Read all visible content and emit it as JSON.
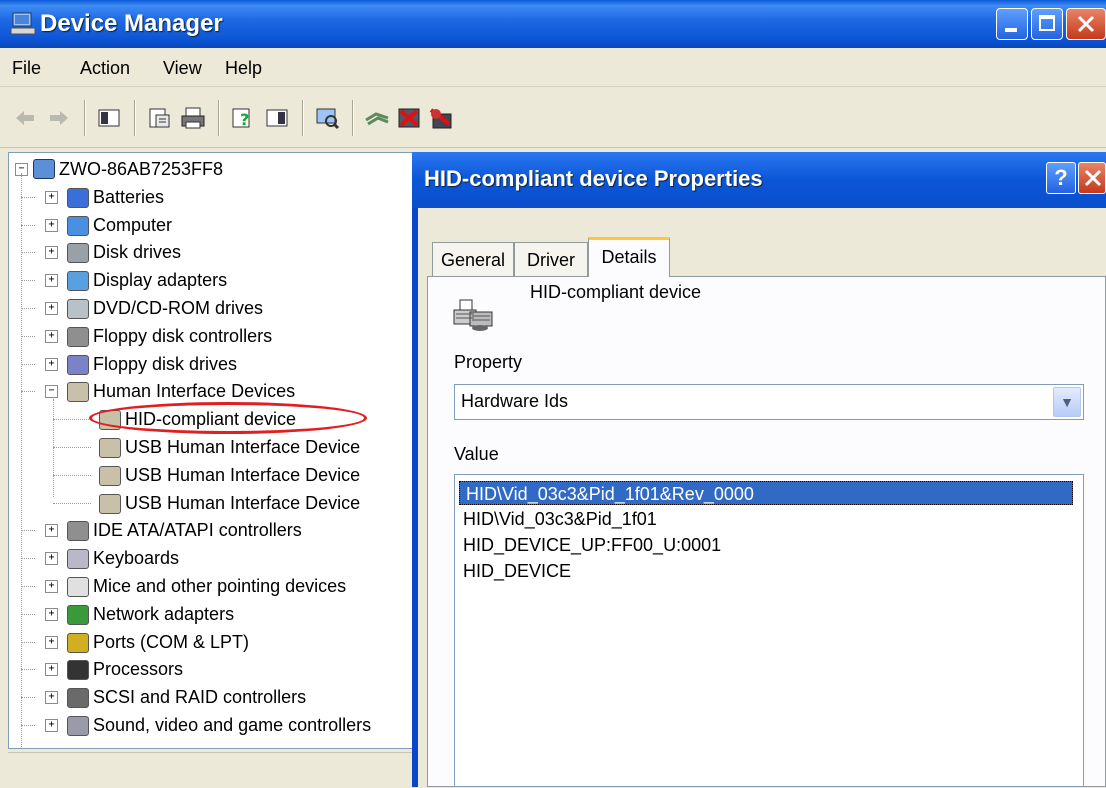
{
  "window": {
    "title": "Device Manager"
  },
  "menu": [
    "File",
    "Action",
    "View",
    "Help"
  ],
  "toolbar": {
    "icons": [
      "back-arrow-icon",
      "forward-arrow-icon",
      "show-hide-tree-icon",
      "properties-icon",
      "print-icon",
      "help-icon",
      "show-hide-pane-icon",
      "scan-hardware-icon",
      "update-driver-icon",
      "disable-device-icon",
      "uninstall-device-icon"
    ]
  },
  "tree": {
    "root": "ZWO-86AB7253FF8",
    "categories": [
      {
        "label": "Batteries",
        "icon": "battery-icon",
        "expanded": false
      },
      {
        "label": "Computer",
        "icon": "computer-icon",
        "expanded": false
      },
      {
        "label": "Disk drives",
        "icon": "disk-drive-icon",
        "expanded": false
      },
      {
        "label": "Display adapters",
        "icon": "display-adapter-icon",
        "expanded": false
      },
      {
        "label": "DVD/CD-ROM drives",
        "icon": "cdrom-icon",
        "expanded": false
      },
      {
        "label": "Floppy disk controllers",
        "icon": "floppy-controller-icon",
        "expanded": false
      },
      {
        "label": "Floppy disk drives",
        "icon": "floppy-drive-icon",
        "expanded": false
      },
      {
        "label": "Human Interface Devices",
        "icon": "hid-icon",
        "expanded": true,
        "children": [
          "HID-compliant device",
          "USB Human Interface Device",
          "USB Human Interface Device",
          "USB Human Interface Device"
        ]
      },
      {
        "label": "IDE ATA/ATAPI controllers",
        "icon": "ide-controller-icon",
        "expanded": false
      },
      {
        "label": "Keyboards",
        "icon": "keyboard-icon",
        "expanded": false
      },
      {
        "label": "Mice and other pointing devices",
        "icon": "mouse-icon",
        "expanded": false
      },
      {
        "label": "Network adapters",
        "icon": "network-adapter-icon",
        "expanded": false
      },
      {
        "label": "Ports (COM & LPT)",
        "icon": "port-icon",
        "expanded": false
      },
      {
        "label": "Processors",
        "icon": "processor-icon",
        "expanded": false
      },
      {
        "label": "SCSI and RAID controllers",
        "icon": "scsi-icon",
        "expanded": false
      },
      {
        "label": "Sound, video and game controllers",
        "icon": "sound-icon",
        "expanded": false
      }
    ],
    "highlighted": "HID-compliant device"
  },
  "dialog": {
    "title": "HID-compliant device Properties",
    "help_glyph": "?",
    "tabs": [
      "General",
      "Driver",
      "Details"
    ],
    "active_tab": "Details",
    "device_name": "HID-compliant device",
    "property_label": "Property",
    "property_value": "Hardware Ids",
    "value_label": "Value",
    "values": [
      "HID\\Vid_03c3&Pid_1f01&Rev_0000",
      "HID\\Vid_03c3&Pid_1f01",
      "HID_DEVICE_UP:FF00_U:0001",
      "HID_DEVICE"
    ],
    "selected_value_index": 0
  },
  "colors": {
    "title_blue": "#0b53d2",
    "selection": "#316ac5",
    "highlight_ring": "#e02020",
    "face": "#ece9d8"
  }
}
